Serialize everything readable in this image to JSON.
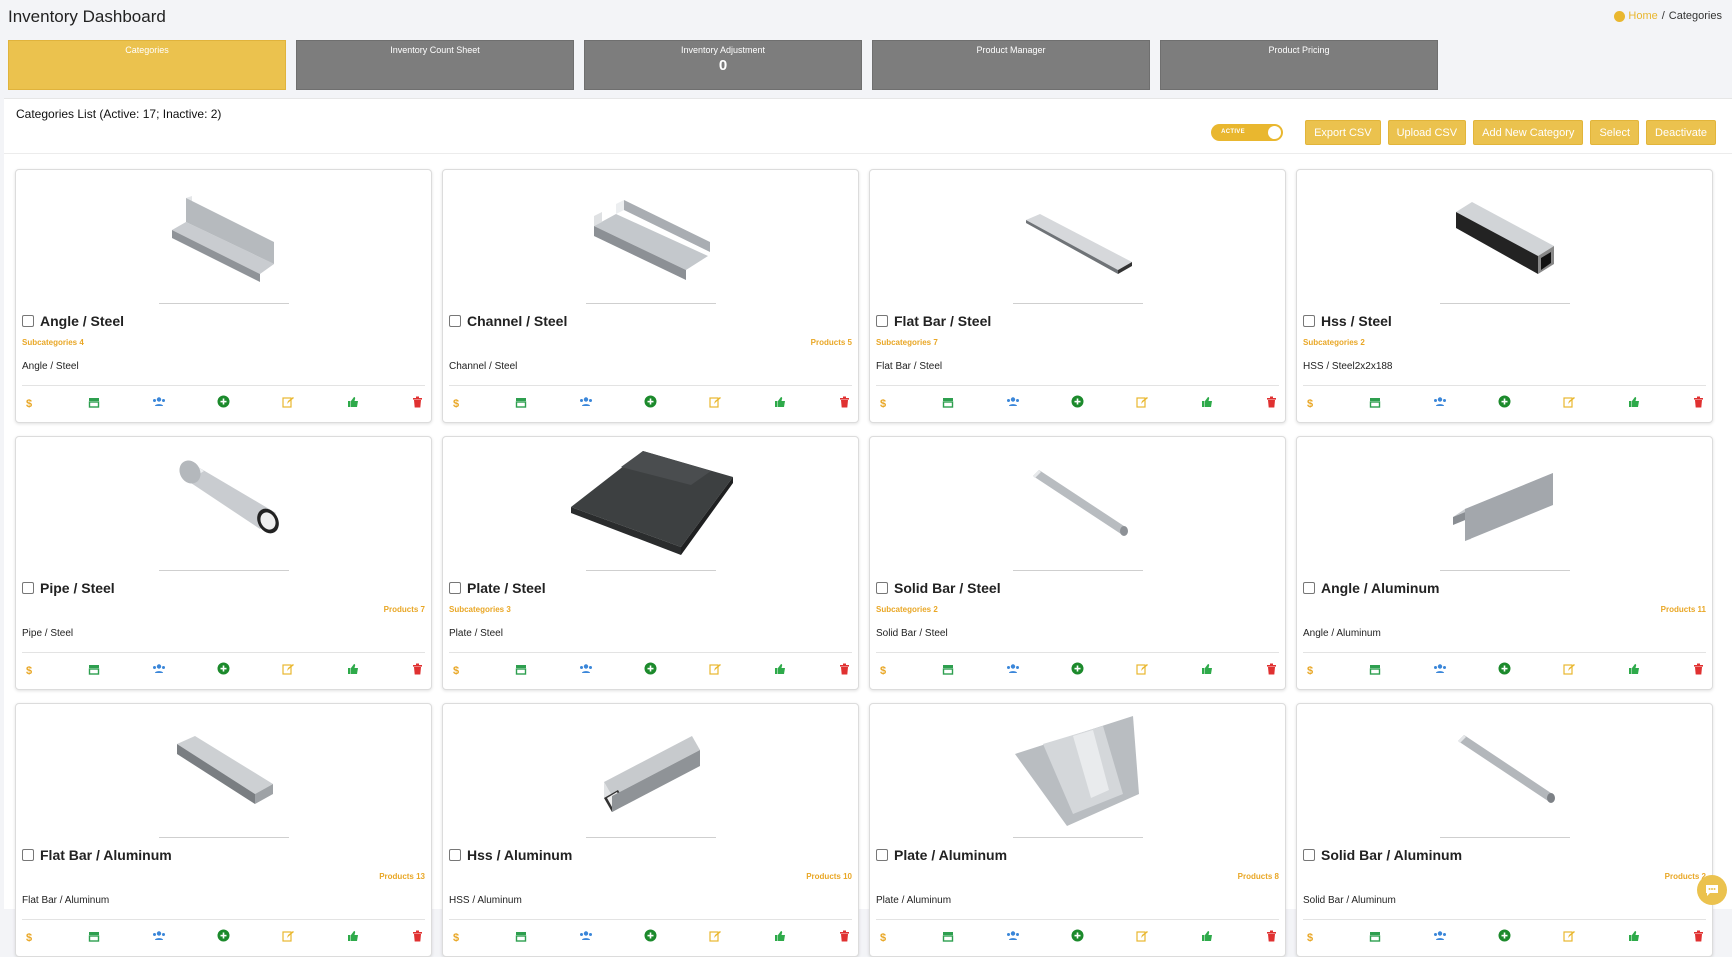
{
  "header": {
    "title": "Inventory Dashboard",
    "breadcrumb_home": "Home",
    "breadcrumb_sep": "/",
    "breadcrumb_current": "Categories"
  },
  "tiles": [
    {
      "label": "Categories",
      "count": "",
      "active": true
    },
    {
      "label": "Inventory Count Sheet",
      "count": ""
    },
    {
      "label": "Inventory Adjustment",
      "count": "0"
    },
    {
      "label": "Product Manager",
      "count": ""
    },
    {
      "label": "Product Pricing",
      "count": ""
    }
  ],
  "list": {
    "title": "Categories List (Active: 17; Inactive: 2)",
    "toggle_label": "ACTIVE",
    "buttons": {
      "export": "Export CSV",
      "upload": "Upload CSV",
      "add": "Add New Category",
      "select": "Select",
      "deactivate": "Deactivate"
    }
  },
  "colors": {
    "accent": "#ebc24e",
    "tile_gray": "#7d7d7d",
    "dollar": "#e9a726",
    "store": "#2e9f4f",
    "users": "#3a86d9",
    "plus": "#1c8a2c",
    "edit": "#e9b72f",
    "thumb": "#2eaa4a",
    "trash": "#e03131"
  },
  "cards": [
    {
      "title": "Angle / Steel",
      "sub": "Subcategories 4",
      "prod": "",
      "desc": "Angle / Steel",
      "img": "angle"
    },
    {
      "title": "Channel / Steel",
      "sub": "",
      "prod": "Products 5",
      "desc": "Channel / Steel",
      "img": "channel"
    },
    {
      "title": "Flat Bar / Steel",
      "sub": "Subcategories 7",
      "prod": "",
      "desc": "Flat Bar / Steel",
      "img": "flatbar"
    },
    {
      "title": "Hss / Steel",
      "sub": "Subcategories 2",
      "prod": "",
      "desc": "HSS / Steel2x2x188",
      "img": "hss"
    },
    {
      "title": "Pipe / Steel",
      "sub": "",
      "prod": "Products 7",
      "desc": "Pipe / Steel",
      "img": "pipe"
    },
    {
      "title": "Plate / Steel",
      "sub": "Subcategories 3",
      "prod": "",
      "desc": "Plate / Steel",
      "img": "plate-dark"
    },
    {
      "title": "Solid Bar / Steel",
      "sub": "Subcategories 2",
      "prod": "",
      "desc": "Solid Bar / Steel",
      "img": "rod"
    },
    {
      "title": "Angle / Aluminum",
      "sub": "",
      "prod": "Products 11",
      "desc": "Angle / Aluminum",
      "img": "angle-alu"
    },
    {
      "title": "Flat Bar / Aluminum",
      "sub": "",
      "prod": "Products 13",
      "desc": "Flat Bar / Aluminum",
      "img": "flatbar-alu"
    },
    {
      "title": "Hss / Aluminum",
      "sub": "",
      "prod": "Products 10",
      "desc": "HSS / Aluminum",
      "img": "hss-alu"
    },
    {
      "title": "Plate / Aluminum",
      "sub": "",
      "prod": "Products 8",
      "desc": "Plate / Aluminum",
      "img": "plate-alu"
    },
    {
      "title": "Solid Bar / Aluminum",
      "sub": "",
      "prod": "Products 2",
      "desc": "Solid Bar / Aluminum",
      "img": "rod-alu"
    }
  ]
}
